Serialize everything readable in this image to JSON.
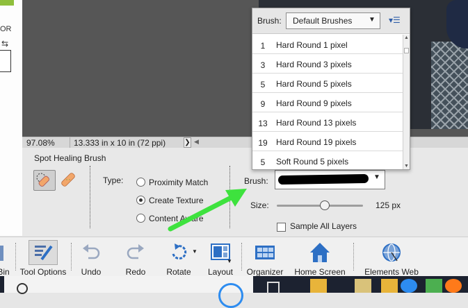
{
  "left_panel": {
    "label": "OR",
    "swap_glyph": "⇆"
  },
  "statusbar": {
    "zoom": "97.08%",
    "dimensions": "13.333 in x 10 in (72 ppi)",
    "more_arrow": "❯"
  },
  "tool_options": {
    "title": "Spot Healing Brush",
    "type_label": "Type:",
    "types": [
      {
        "label": "Proximity Match",
        "selected": false
      },
      {
        "label": "Create Texture",
        "selected": true
      },
      {
        "label": "Content Aware",
        "selected": false
      }
    ],
    "brush_label": "Brush:",
    "size_label": "Size:",
    "size_value": "125 px",
    "size_fraction": 0.55,
    "sample_all_layers": "Sample All Layers",
    "sample_all_checked": false
  },
  "brush_dropdown": {
    "label": "Brush:",
    "library": "Default Brushes",
    "brushes": [
      {
        "size": "1",
        "name": "Hard Round 1 pixel"
      },
      {
        "size": "3",
        "name": "Hard Round 3 pixels"
      },
      {
        "size": "5",
        "name": "Hard Round 5 pixels"
      },
      {
        "size": "9",
        "name": "Hard Round 9 pixels"
      },
      {
        "size": "13",
        "name": "Hard Round 13 pixels"
      },
      {
        "size": "19",
        "name": "Hard Round 19 pixels"
      },
      {
        "size": "5",
        "name": "Soft Round 5 pixels"
      }
    ]
  },
  "toolbar": {
    "bin": "Bin",
    "tool_options": "Tool Options",
    "undo": "Undo",
    "redo": "Redo",
    "rotate": "Rotate",
    "layout": "Layout",
    "organizer": "Organizer",
    "home_screen": "Home Screen",
    "elements_web": "Elements Web"
  },
  "colors": {
    "accent": "#2d6fc4",
    "annotation_arrow": "#3ee23e"
  }
}
